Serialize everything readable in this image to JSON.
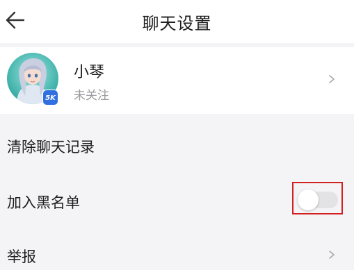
{
  "header": {
    "title": "聊天设置",
    "back_icon": "arrow-left-icon"
  },
  "user": {
    "name": "小琴",
    "follow_status": "未关注",
    "badge_text": "5K"
  },
  "settings": [
    {
      "label": "清除聊天记录"
    },
    {
      "label": "加入黑名单",
      "toggle_on": false
    },
    {
      "label": "举报"
    }
  ],
  "colors": {
    "highlight": "#d22020",
    "badge": "#2f6fe0",
    "toggle_off": "#e3e3e6"
  }
}
